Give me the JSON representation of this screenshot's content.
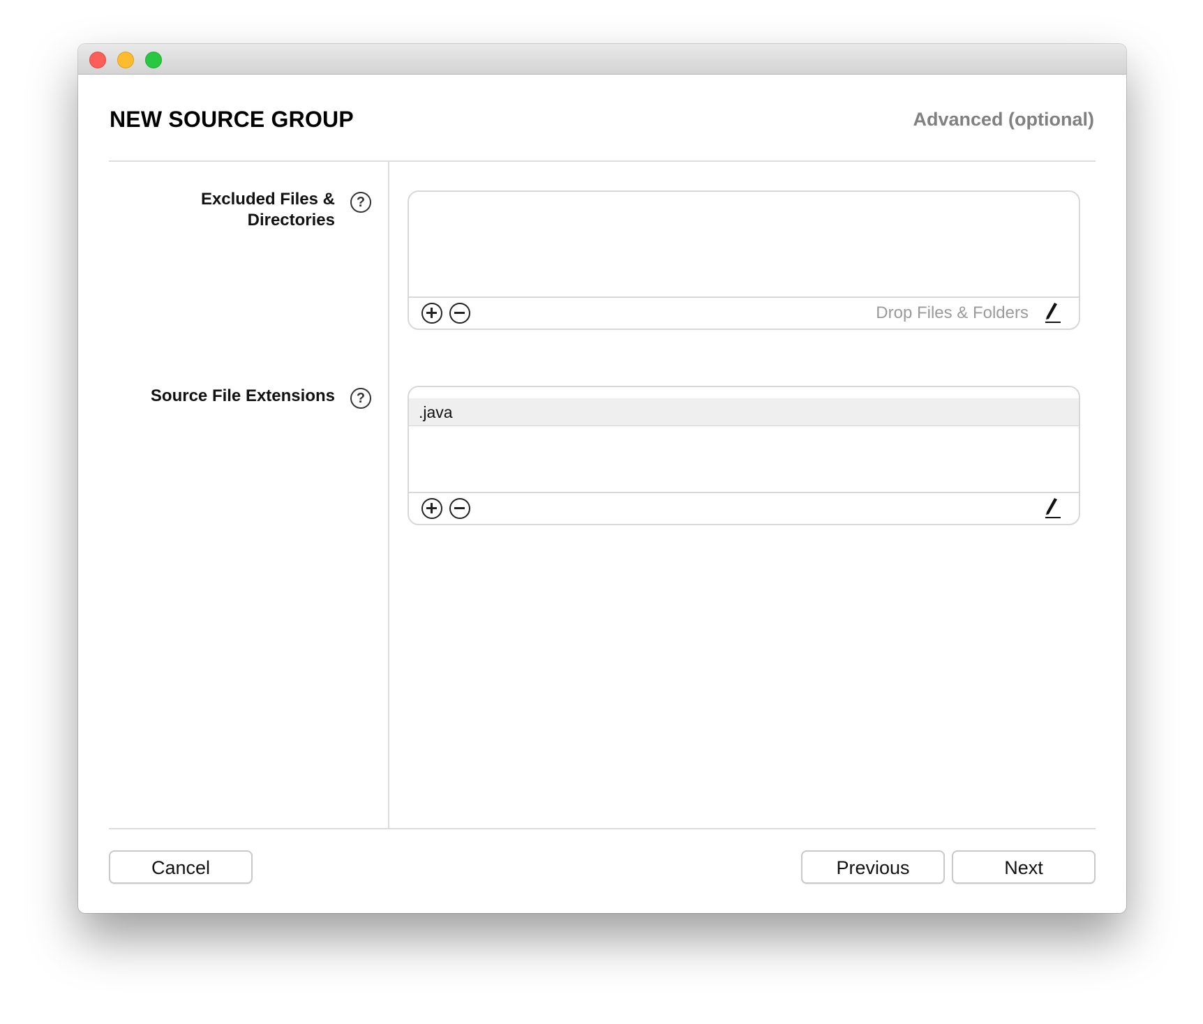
{
  "window": {
    "controls": {
      "close": "close-icon",
      "minimize": "minimize-icon",
      "zoom": "zoom-icon"
    }
  },
  "header": {
    "title": "NEW SOURCE GROUP",
    "step_label": "Advanced (optional)"
  },
  "excluded": {
    "label": "Excluded Files & Directories",
    "help_glyph": "?",
    "items": [],
    "drop_hint": "Drop Files & Folders",
    "icons": [
      "add-icon",
      "remove-icon",
      "pencil-icon"
    ]
  },
  "extensions": {
    "label": "Source File Extensions",
    "help_glyph": "?",
    "items": [
      ".java"
    ],
    "icons": [
      "add-icon",
      "remove-icon",
      "pencil-icon"
    ]
  },
  "footer": {
    "cancel_label": "Cancel",
    "previous_label": "Previous",
    "next_label": "Next"
  },
  "colors": {
    "close": "#fc5f57",
    "minimize": "#fdbc2e",
    "zoom": "#28c841",
    "muted_text": "#808080"
  }
}
